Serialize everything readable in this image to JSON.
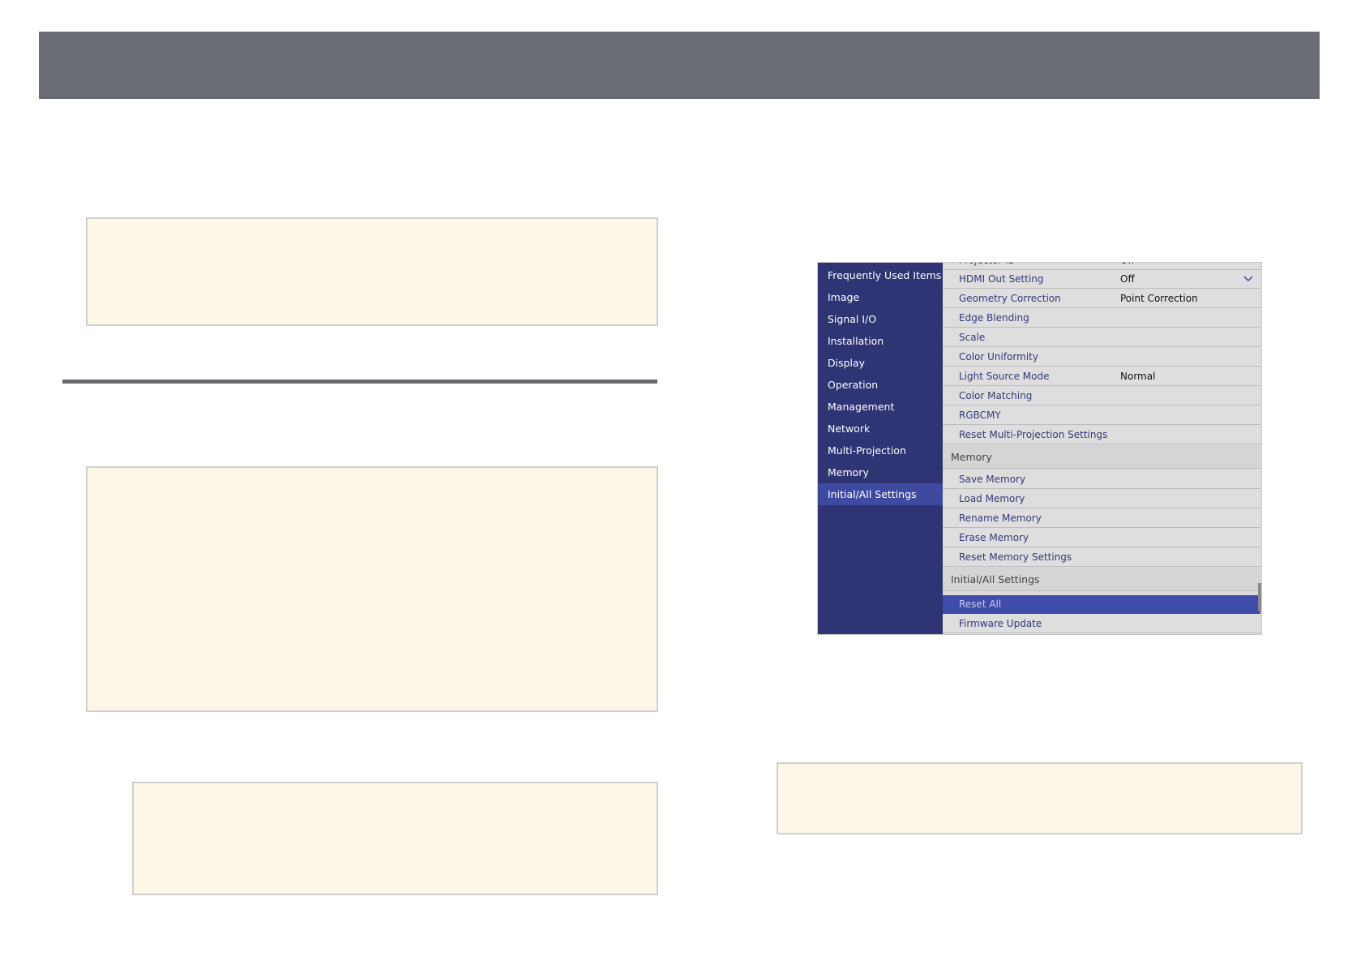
{
  "colors": {
    "header_band": "#696c74",
    "note_fill": "#fcf7e6",
    "sidebar": "#2e3474",
    "sidebar_active": "#3d4aa0",
    "row_selected": "#3f4caa"
  },
  "menu": {
    "sidebar": [
      {
        "label": "Frequently Used Items"
      },
      {
        "label": "Image"
      },
      {
        "label": "Signal I/O"
      },
      {
        "label": "Installation"
      },
      {
        "label": "Display"
      },
      {
        "label": "Operation"
      },
      {
        "label": "Management"
      },
      {
        "label": "Network"
      },
      {
        "label": "Multi-Projection"
      },
      {
        "label": "Memory"
      },
      {
        "label": "Initial/All Settings",
        "active": true
      }
    ],
    "partial_row": {
      "label": "Projector ID",
      "value": "Off"
    },
    "rows": [
      {
        "label": "HDMI Out Setting",
        "value": "Off",
        "icon": "chevron-down-icon"
      },
      {
        "label": "Geometry Correction",
        "value": "Point Correction"
      },
      {
        "label": "Edge Blending",
        "value": ""
      },
      {
        "label": "Scale",
        "value": ""
      },
      {
        "label": "Color Uniformity",
        "value": ""
      },
      {
        "label": "Light Source Mode",
        "value": "Normal"
      },
      {
        "label": "Color Matching",
        "value": ""
      },
      {
        "label": "RGBCMY",
        "value": ""
      },
      {
        "label": "Reset Multi-Projection Settings",
        "value": ""
      }
    ],
    "memory_section": {
      "title": "Memory",
      "rows": [
        {
          "label": "Save Memory"
        },
        {
          "label": "Load Memory"
        },
        {
          "label": "Rename Memory"
        },
        {
          "label": "Erase Memory"
        },
        {
          "label": "Reset Memory Settings"
        }
      ]
    },
    "initial_section": {
      "title": "Initial/All Settings",
      "rows": [
        {
          "label": "Reset All",
          "selected": true
        },
        {
          "label": "Firmware Update"
        }
      ]
    }
  }
}
